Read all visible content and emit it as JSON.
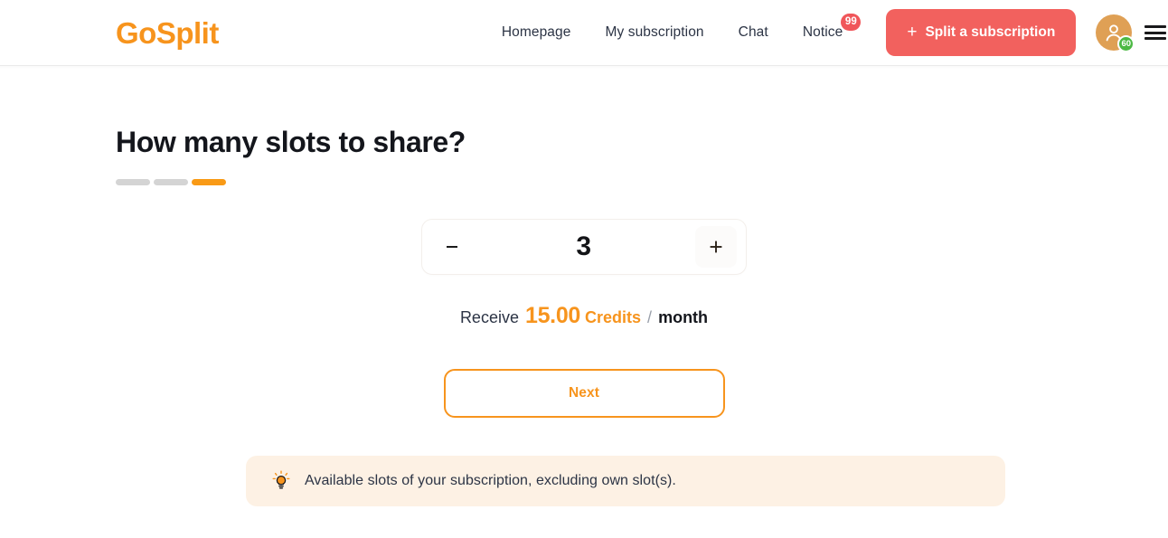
{
  "header": {
    "logo": "GoSplit",
    "nav": [
      {
        "label": "Homepage",
        "badge": null
      },
      {
        "label": "My subscription",
        "badge": null
      },
      {
        "label": "Chat",
        "badge": null
      },
      {
        "label": "Notice",
        "badge": "99"
      }
    ],
    "split_button": {
      "plus": "+",
      "label": "Split a subscription"
    },
    "avatar": {
      "icon": "user-icon",
      "badge": "60"
    },
    "menu_icon": "hamburger-menu-icon"
  },
  "main": {
    "title": "How many slots to share?",
    "steps": {
      "total": 3,
      "active_index": 2
    },
    "stepper": {
      "decrement_icon": "minus-icon",
      "increment_icon": "plus-icon",
      "value": "3"
    },
    "receive": {
      "label": "Receive",
      "amount": "15.00",
      "currency": "Credits",
      "separator": "/",
      "period": "month"
    },
    "next_button": "Next",
    "info_banner": {
      "icon": "lightbulb-icon",
      "text": "Available slots of your subscription, excluding own slot(s)."
    }
  },
  "colors": {
    "brand_orange": "#f7941d",
    "accent_red": "#f2615e",
    "badge_green": "#4cb944",
    "banner_bg": "#fdf1e4",
    "step_inactive": "#d4d4d4"
  }
}
